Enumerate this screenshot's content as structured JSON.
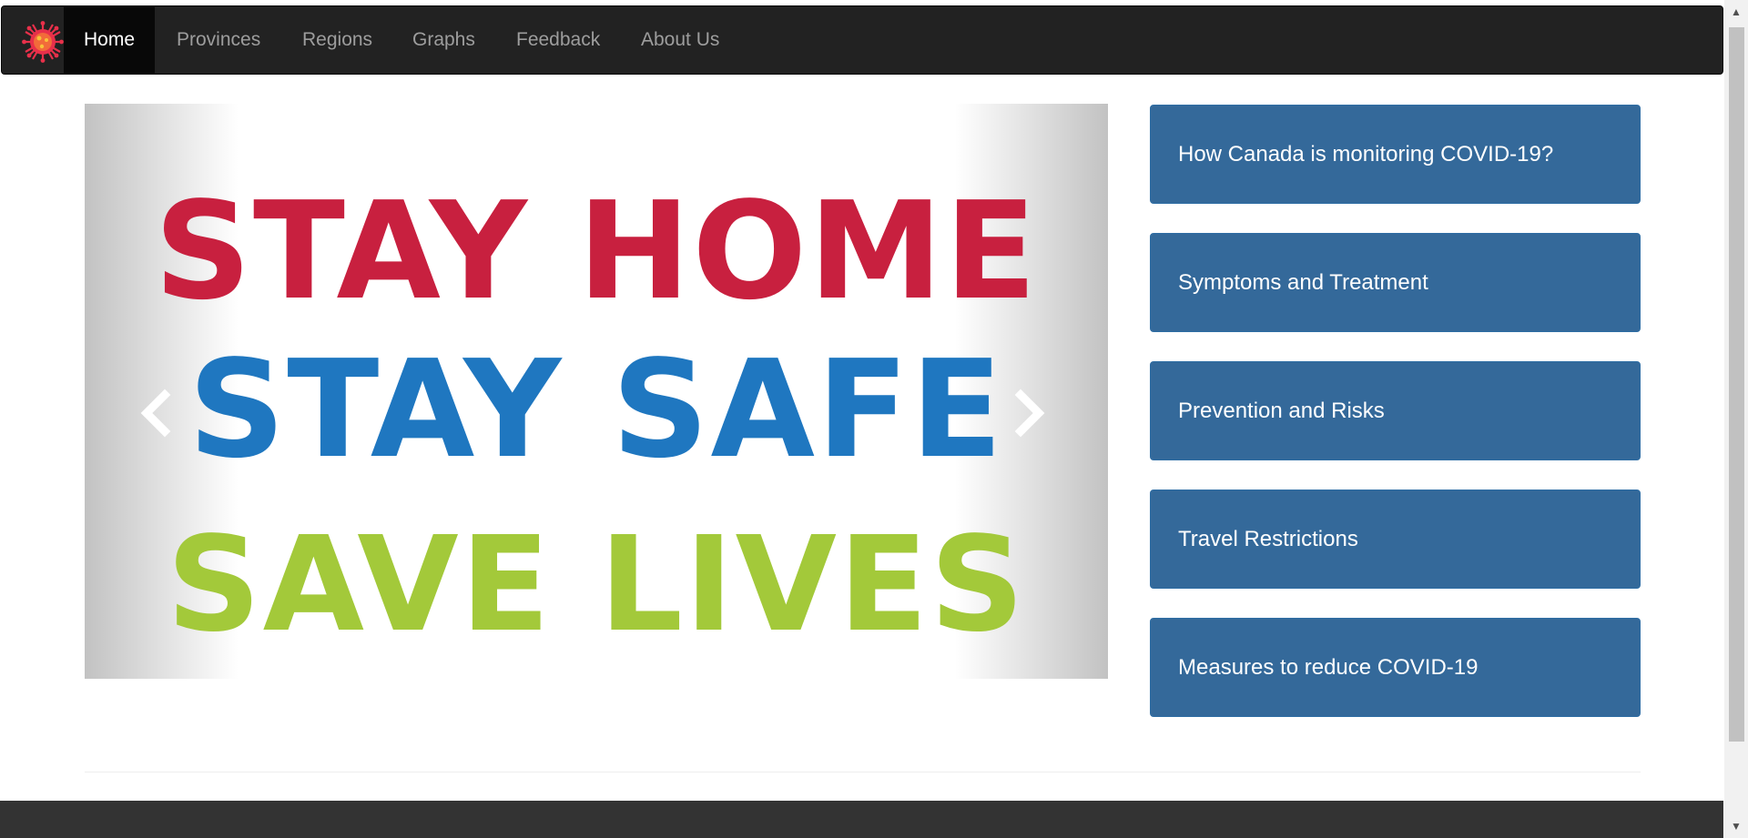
{
  "nav": {
    "items": [
      {
        "label": "Home",
        "active": true
      },
      {
        "label": "Provinces",
        "active": false
      },
      {
        "label": "Regions",
        "active": false
      },
      {
        "label": "Graphs",
        "active": false
      },
      {
        "label": "Feedback",
        "active": false
      },
      {
        "label": "About Us",
        "active": false
      }
    ]
  },
  "carousel": {
    "slide_lines": [
      {
        "text": "STAY HOME",
        "color": "#c8203f"
      },
      {
        "text": "STAY SAFE",
        "color": "#1f77c0"
      },
      {
        "text": "SAVE LIVES",
        "color": "#a3c93a"
      }
    ],
    "indicator_count": 2,
    "active_indicator": 0
  },
  "side_buttons": [
    {
      "label": "How Canada is monitoring COVID-19?"
    },
    {
      "label": "Symptoms and Treatment"
    },
    {
      "label": "Prevention and Risks"
    },
    {
      "label": "Travel Restrictions"
    },
    {
      "label": "Measures to reduce COVID-19"
    }
  ],
  "colors": {
    "navbar_bg": "#222222",
    "nav_active_bg": "#080808",
    "side_button_bg": "#34699a",
    "footer_bg": "#333333"
  }
}
